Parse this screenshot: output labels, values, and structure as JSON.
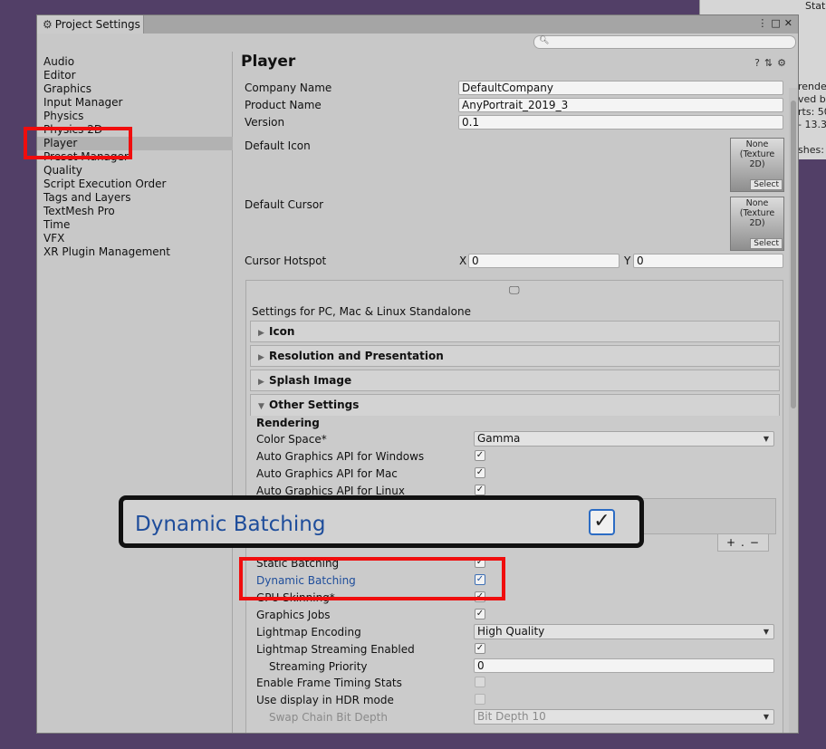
{
  "background_window": {
    "title": "Stati",
    "lines": [
      "render",
      "ved b",
      "rts: 50",
      "- 13.3",
      "shes:"
    ]
  },
  "window": {
    "tab_title": "Project Settings",
    "search_placeholder": ""
  },
  "sidebar": {
    "items": [
      {
        "label": "Audio"
      },
      {
        "label": "Editor"
      },
      {
        "label": "Graphics"
      },
      {
        "label": "Input Manager"
      },
      {
        "label": "Physics"
      },
      {
        "label": "Physics 2D"
      },
      {
        "label": "Player"
      },
      {
        "label": "Preset Manager"
      },
      {
        "label": "Quality"
      },
      {
        "label": "Script Execution Order"
      },
      {
        "label": "Tags and Layers"
      },
      {
        "label": "TextMesh Pro"
      },
      {
        "label": "Time"
      },
      {
        "label": "VFX"
      },
      {
        "label": "XR Plugin Management"
      }
    ],
    "selected": "Player"
  },
  "player": {
    "title": "Player",
    "company_name_label": "Company Name",
    "company_name": "DefaultCompany",
    "product_name_label": "Product Name",
    "product_name": "AnyPortrait_2019_3",
    "version_label": "Version",
    "version": "0.1",
    "default_icon_label": "Default Icon",
    "default_cursor_label": "Default Cursor",
    "texture_none": "None",
    "texture_type": "(Texture 2D)",
    "select_label": "Select",
    "cursor_hotspot_label": "Cursor Hotspot",
    "hotspot_x_label": "X",
    "hotspot_x": "0",
    "hotspot_y_label": "Y",
    "hotspot_y": "0"
  },
  "platform": {
    "settings_title": "Settings for PC, Mac & Linux Standalone",
    "sections": [
      "Icon",
      "Resolution and Presentation",
      "Splash Image",
      "Other Settings"
    ]
  },
  "other_settings": {
    "rendering_label": "Rendering",
    "color_space_label": "Color Space*",
    "color_space": "Gamma",
    "auto_api_windows_label": "Auto Graphics API  for Windows",
    "auto_api_mac_label": "Auto Graphics API  for Mac",
    "auto_api_linux_label": "Auto Graphics API  for Linux",
    "static_batching_label": "Static Batching",
    "dynamic_batching_label": "Dynamic Batching",
    "gpu_skinning_label": "GPU Skinning*",
    "graphics_jobs_label": "Graphics Jobs",
    "lightmap_encoding_label": "Lightmap Encoding",
    "lightmap_encoding": "High Quality",
    "lightmap_streaming_label": "Lightmap Streaming Enabled",
    "streaming_priority_label": "Streaming Priority",
    "streaming_priority": "0",
    "frame_timing_label": "Enable Frame Timing Stats",
    "hdr_label": "Use display in HDR mode",
    "swap_chain_label": "Swap Chain Bit Depth",
    "swap_chain": "Bit Depth 10",
    "checked": {
      "auto_api_windows": true,
      "auto_api_mac": true,
      "auto_api_linux": true,
      "static_batching": true,
      "dynamic_batching": true,
      "gpu_skinning": true,
      "graphics_jobs": true,
      "lightmap_streaming": true,
      "frame_timing": false,
      "hdr": false
    },
    "list_add": "+.",
    "list_remove": "−"
  },
  "callout": {
    "label": "Dynamic Batching",
    "checked": true
  },
  "colors": {
    "highlight_red": "#f00d0d",
    "callout_border": "#111111",
    "link_blue": "#1e4d9b",
    "desktop_purple": "#523f67"
  },
  "icons": {
    "tab": "gear-icon",
    "search": "search-icon",
    "help": "help-icon",
    "preset": "preset-icon",
    "settings": "gear-icon",
    "monitor": "monitor-icon",
    "check": "check-icon"
  }
}
